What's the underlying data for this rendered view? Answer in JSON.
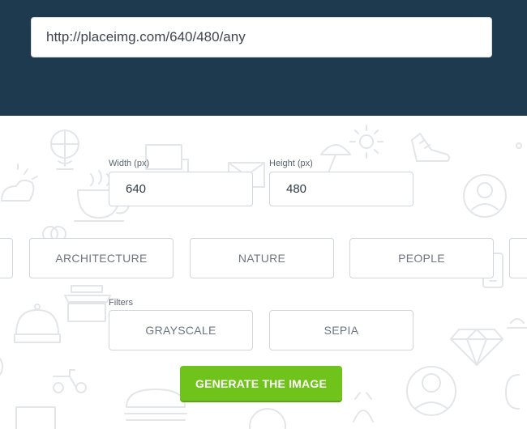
{
  "header": {
    "url_value": "http://placeimg.com/640/480/any"
  },
  "dimensions": {
    "width_label": "Width (px)",
    "width_value": "640",
    "height_label": "Height (px)",
    "height_value": "480"
  },
  "categories": [
    {
      "label": ""
    },
    {
      "label": "ARCHITECTURE"
    },
    {
      "label": "NATURE"
    },
    {
      "label": "PEOPLE"
    },
    {
      "label": ""
    }
  ],
  "filters": {
    "label": "Filters",
    "options": [
      {
        "label": "GRAYSCALE"
      },
      {
        "label": "SEPIA"
      }
    ]
  },
  "generate_button": {
    "label": "GENERATE THE IMAGE"
  },
  "colors": {
    "header_bg": "#1e3a4f",
    "accent_green": "#6fc31b",
    "border": "#cfd6dc",
    "icon_line": "#e4e7ea"
  }
}
